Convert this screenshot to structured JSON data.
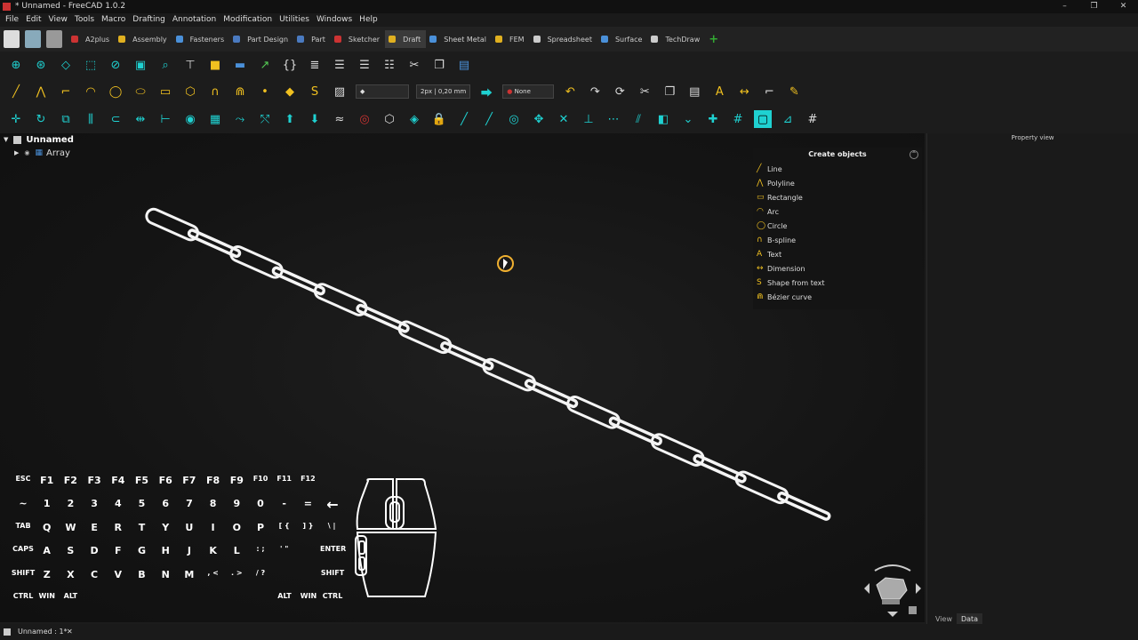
{
  "window": {
    "title": "* Unnamed - FreeCAD 1.0.2",
    "controls": [
      "–",
      "❐",
      "✕"
    ]
  },
  "menu": [
    "File",
    "Edit",
    "View",
    "Tools",
    "Macro",
    "Drafting",
    "Annotation",
    "Modification",
    "Utilities",
    "Windows",
    "Help"
  ],
  "workbenches": [
    {
      "label": "A2plus",
      "color": "#c33"
    },
    {
      "label": "Assembly",
      "color": "#e0b020"
    },
    {
      "label": "Fasteners",
      "color": "#4a90d9"
    },
    {
      "label": "Part Design",
      "color": "#4a7ac0"
    },
    {
      "label": "Part",
      "color": "#4a7ac0"
    },
    {
      "label": "Sketcher",
      "color": "#c33"
    },
    {
      "label": "Draft",
      "color": "#e0b020",
      "active": true
    },
    {
      "label": "Sheet Metal",
      "color": "#4a90d9"
    },
    {
      "label": "FEM",
      "color": "#e0b020"
    },
    {
      "label": "Spreadsheet",
      "color": "#ccc"
    },
    {
      "label": "Surface",
      "color": "#4a90d9"
    },
    {
      "label": "TechDraw",
      "color": "#ccc"
    },
    {
      "label": "+",
      "color": "#3a3"
    }
  ],
  "draft_tray": {
    "line_width": "2px | 0,20 mm",
    "autogroup": "None"
  },
  "tree": {
    "root": "Unnamed",
    "child": "Array"
  },
  "create_objects": {
    "title": "Create objects",
    "items": [
      {
        "label": "Line",
        "icon": "line-icon"
      },
      {
        "label": "Polyline",
        "icon": "polyline-icon"
      },
      {
        "label": "Rectangle",
        "icon": "rectangle-icon"
      },
      {
        "label": "Arc",
        "icon": "arc-icon"
      },
      {
        "label": "Circle",
        "icon": "circle-icon"
      },
      {
        "label": "B-spline",
        "icon": "bspline-icon"
      },
      {
        "label": "Text",
        "icon": "text-icon"
      },
      {
        "label": "Dimension",
        "icon": "dimension-icon"
      },
      {
        "label": "Shape from text",
        "icon": "shapestring-icon"
      },
      {
        "label": "Bézier curve",
        "icon": "bezier-icon"
      }
    ]
  },
  "property_view": {
    "title": "Property view",
    "tabs": [
      "View",
      "Data"
    ]
  },
  "status": {
    "doc_tab": "Unnamed : 1*"
  },
  "keyboard": {
    "rows": [
      [
        "ESC",
        "F1",
        "F2",
        "F3",
        "F4",
        "F5",
        "F6",
        "F7",
        "F8",
        "F9",
        "F10",
        "F11",
        "F12"
      ],
      [
        "~",
        "1",
        "2",
        "3",
        "4",
        "5",
        "6",
        "7",
        "8",
        "9",
        "0",
        "-",
        "="
      ],
      [
        "TAB",
        "Q",
        "W",
        "E",
        "R",
        "T",
        "Y",
        "U",
        "I",
        "O",
        "P",
        "[ {",
        "] }",
        "\\ |"
      ],
      [
        "CAPS",
        "A",
        "S",
        "D",
        "F",
        "G",
        "H",
        "J",
        "K",
        "L",
        ": ;",
        "' \""
      ],
      [
        "SHIFT",
        "Z",
        "X",
        "C",
        "V",
        "B",
        "N",
        "M",
        ", <",
        ". >",
        "/ ?"
      ],
      [
        "CTRL",
        "WIN",
        "ALT"
      ]
    ],
    "right_keys": [
      "ENTER",
      "SHIFT"
    ],
    "bottom_right": [
      "ALT",
      "WIN",
      "CTRL"
    ]
  }
}
